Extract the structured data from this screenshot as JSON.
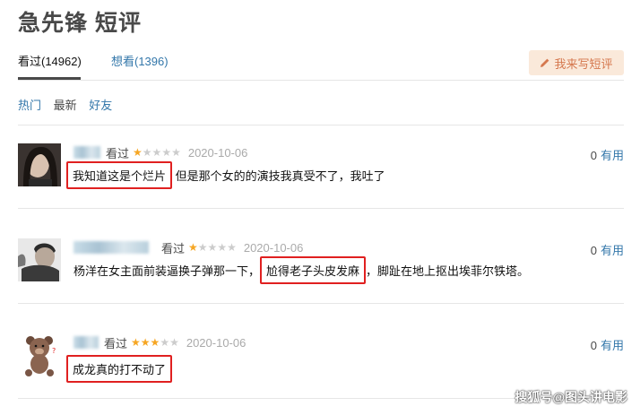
{
  "page_title": "急先锋 短评",
  "tabs": [
    {
      "label": "看过(14962)"
    },
    {
      "label": "想看(1396)"
    }
  ],
  "write_button_label": "我来写短评",
  "filters": [
    "热门",
    "最新",
    "好友"
  ],
  "reviews": [
    {
      "status": "看过",
      "stars": 1,
      "date": "2020-10-06",
      "useful_count": "0",
      "useful_label": "有用",
      "content_parts": [
        "我知道这是个烂片",
        "  但是那个女的的演技我真受不了，我吐了"
      ]
    },
    {
      "status": "看过",
      "stars": 1,
      "date": "2020-10-06",
      "useful_count": "0",
      "useful_label": "有用",
      "content_parts": [
        "杨洋在女主面前装逼换子弹那一下，",
        "尬得老子头皮发麻",
        "，脚趾在地上抠出埃菲尔铁塔。"
      ]
    },
    {
      "status": "看过",
      "stars": 3,
      "date": "2020-10-06",
      "useful_count": "0",
      "useful_label": "有用",
      "content_parts": [
        "成龙真的打不动了"
      ]
    }
  ],
  "watermark": "搜狐号@图头讲电影",
  "colors": {
    "link": "#3377aa",
    "star": "#f6a623",
    "highlight_box": "#e02020",
    "write_button_bg": "#fae9da"
  }
}
